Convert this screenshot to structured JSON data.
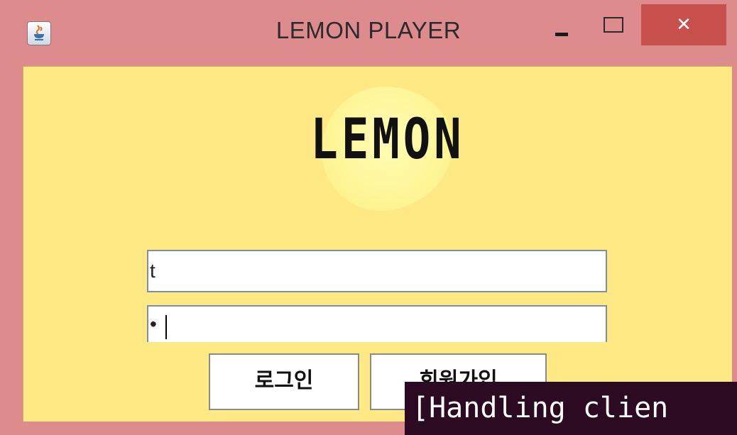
{
  "window": {
    "title": "LEMON PLAYER",
    "close_glyph": "✕",
    "icons": [
      "java-cup-icon",
      "minimize-icon",
      "maximize-icon",
      "close-icon"
    ]
  },
  "logo": {
    "text": "LEMON"
  },
  "login_form": {
    "id_value": "t",
    "password_value": "•"
  },
  "buttons": {
    "login_label": "로그인",
    "signup_label": "회원가입"
  },
  "terminal": {
    "text": "[Handling clien"
  },
  "colors": {
    "window_frame": "#de8b8e",
    "content_background": "#ffe985",
    "close_button": "#c7504d",
    "terminal_background": "#2c0a22"
  }
}
